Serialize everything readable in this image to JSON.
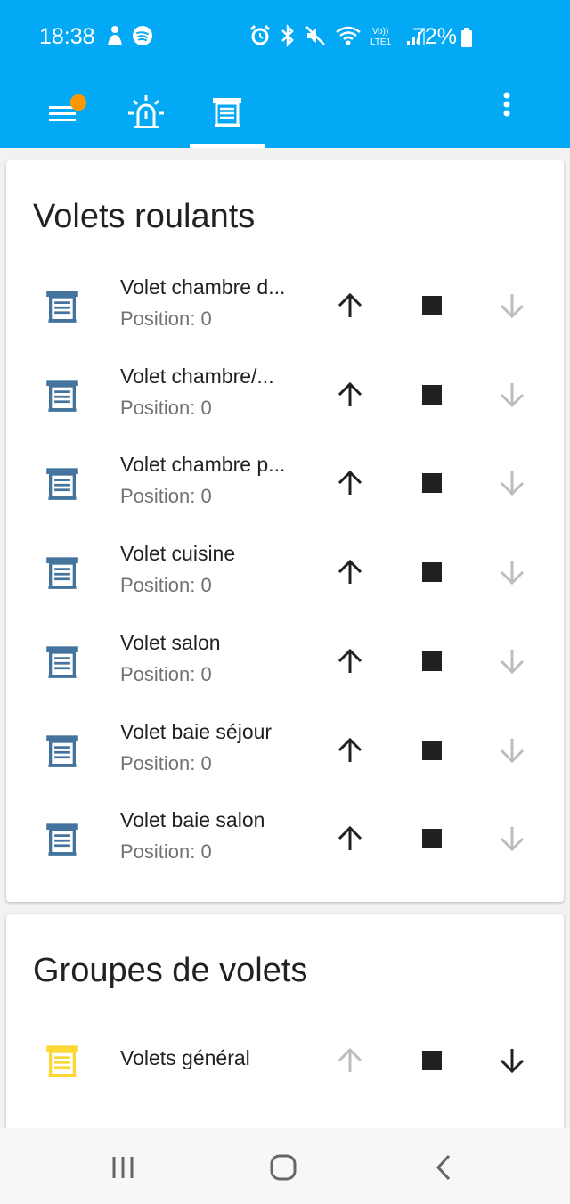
{
  "status_bar": {
    "time": "18:38",
    "battery": "72%",
    "left_icons": [
      "person-icon",
      "spotify-icon"
    ],
    "right_icons": [
      "alarm-icon",
      "bluetooth-icon",
      "mute-icon",
      "wifi-icon",
      "volte-icon",
      "signal-icon"
    ]
  },
  "tabs": [
    {
      "icon": "menu-badge-icon",
      "selected": false
    },
    {
      "icon": "alarm-light-icon",
      "selected": false
    },
    {
      "icon": "shutter-icon",
      "selected": true
    }
  ],
  "colors": {
    "primary": "#03a9f4",
    "badge": "#ff9800",
    "shutter_icon": "#44739e",
    "group_icon": "#fdd835",
    "disabled": "#bdbdbd"
  },
  "cards": [
    {
      "title": "Volets roulants",
      "entities": [
        {
          "name": "Volet chambre d...",
          "position": "Position: 0",
          "up_enabled": true,
          "down_enabled": false
        },
        {
          "name": "Volet chambre/...",
          "position": "Position: 0",
          "up_enabled": true,
          "down_enabled": false
        },
        {
          "name": "Volet chambre p...",
          "position": "Position: 0",
          "up_enabled": true,
          "down_enabled": false
        },
        {
          "name": "Volet cuisine",
          "position": "Position: 0",
          "up_enabled": true,
          "down_enabled": false
        },
        {
          "name": "Volet salon",
          "position": "Position: 0",
          "up_enabled": true,
          "down_enabled": false
        },
        {
          "name": "Volet baie séjour",
          "position": "Position: 0",
          "up_enabled": true,
          "down_enabled": false
        },
        {
          "name": "Volet baie salon",
          "position": "Position: 0",
          "up_enabled": true,
          "down_enabled": false
        }
      ]
    },
    {
      "title": "Groupes de volets",
      "entities": [
        {
          "name": "Volets général",
          "up_enabled": false,
          "down_enabled": true
        }
      ]
    }
  ],
  "nav_bar": [
    "recent-apps-icon",
    "home-icon",
    "back-icon"
  ]
}
